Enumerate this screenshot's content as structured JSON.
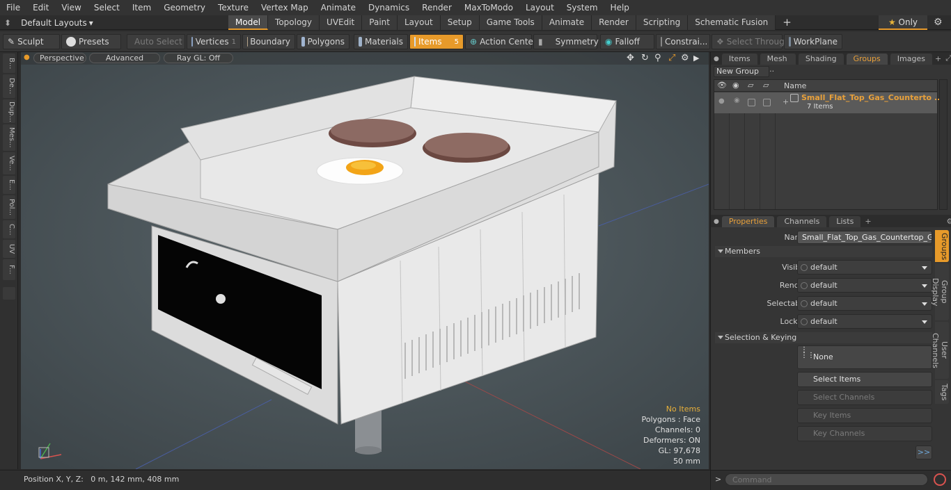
{
  "menu": [
    "File",
    "Edit",
    "View",
    "Select",
    "Item",
    "Geometry",
    "Texture",
    "Vertex Map",
    "Animate",
    "Dynamics",
    "Render",
    "MaxToModo",
    "Layout",
    "System",
    "Help"
  ],
  "layout_dropdown": "Default Layouts",
  "mode_tabs": [
    "Model",
    "Topology",
    "UVEdit",
    "Paint",
    "Layout",
    "Setup",
    "Game Tools",
    "Animate",
    "Render",
    "Scripting",
    "Schematic Fusion"
  ],
  "only_label": "Only",
  "toolbar": {
    "sculpt": "Sculpt",
    "presets": "Presets",
    "auto_select": "Auto Select",
    "vertices": "Vertices",
    "vertices_count": "1",
    "boundary": "Boundary",
    "polygons": "Polygons",
    "materials": "Materials",
    "items": "Items",
    "items_count": "5",
    "action_center": "Action Center",
    "symmetry": "Symmetry",
    "falloff": "Falloff",
    "constraints": "Constrai...",
    "select_through": "Select Through",
    "workplane": "WorkPlane"
  },
  "left_tabs": [
    "B...",
    "De...",
    "Dup...",
    "Mes...",
    "Ve...",
    "E...",
    "Pol...",
    "C...",
    "UV",
    "F..."
  ],
  "viewport": {
    "view": "Perspective",
    "shading": "Advanced",
    "raygl": "Ray GL: Off",
    "stats": {
      "no_items": "No Items",
      "polygons": "Polygons : Face",
      "channels": "Channels: 0",
      "deformers": "Deformers: ON",
      "gl": "GL: 97,678",
      "scale": "50 mm"
    }
  },
  "status": {
    "position": "Position X, Y, Z:   0 m, 142 mm, 408 mm"
  },
  "top_panel": {
    "tabs": [
      "Items",
      "Mesh ...",
      "Shading",
      "Groups",
      "Images"
    ],
    "new_group": "New Group",
    "col_name": "Name",
    "group_name": "Small_Flat_Top_Gas_Counterto ...",
    "group_count": "7 Items"
  },
  "properties": {
    "tabs": [
      "Properties",
      "Channels",
      "Lists"
    ],
    "name_label": "Name",
    "name_value": "Small_Flat_Top_Gas_Countertop_Grid",
    "members": "Members",
    "rows": [
      {
        "label": "Visible",
        "value": "default"
      },
      {
        "label": "Render",
        "value": "default"
      },
      {
        "label": "Selectable",
        "value": "default"
      },
      {
        "label": "Locked",
        "value": "default"
      }
    ],
    "selection_keying": "Selection & Keying",
    "none": "None",
    "select_items": "Select Items",
    "select_channels": "Select Channels",
    "key_items": "Key Items",
    "key_channels": "Key Channels",
    "more": ">>",
    "side_tabs": [
      "Groups",
      "Group Display",
      "User Channels",
      "Tags"
    ]
  },
  "command_placeholder": "Command",
  "colors": {
    "accent": "#e79a2a",
    "viewport": "#4d575c",
    "group_name": "#e8a03a"
  }
}
